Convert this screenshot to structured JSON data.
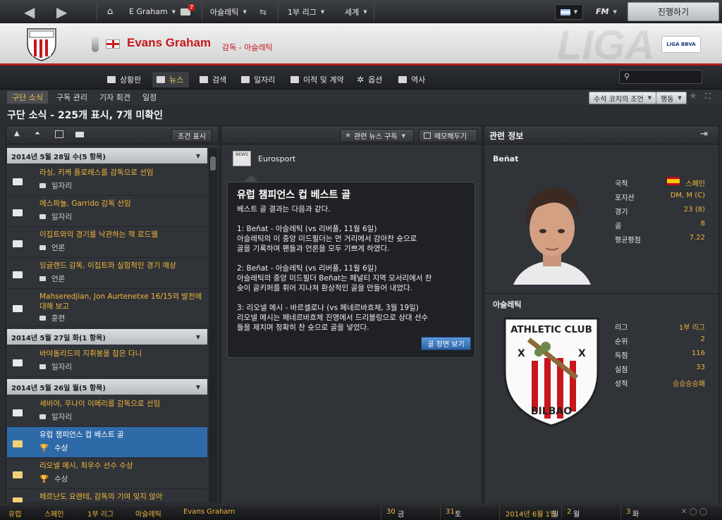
{
  "topbar": {
    "manager": "E Graham",
    "mail_badge": "7",
    "club": "아슬레틱",
    "league": "1부 리그",
    "world": "세계",
    "fm_label": "FM",
    "continue_label": "진행하기"
  },
  "header": {
    "manager_name": "Evans Graham",
    "role": "감독 - 아슬레틱",
    "league_logo": "LIGA BBVA"
  },
  "nav": {
    "tabs": [
      "상황판",
      "뉴스",
      "검색",
      "일자리",
      "이적 및 계약",
      "옵션",
      "역사"
    ],
    "active": "뉴스",
    "search_placeholder": ""
  },
  "subnav": {
    "tabs": [
      "구단 소식",
      "구독 관리",
      "기자 회견",
      "일정"
    ],
    "active": "구단 소식",
    "advice_button": "수석 코치의 조언",
    "action_button": "행동"
  },
  "page_heading": "구단 소식 - 225개 표시, 7개 미확인",
  "left_panel": {
    "filter_button": "조건 표시",
    "groups": [
      {
        "header": "2014년 5월 28일 수(5 항목)",
        "items": [
          {
            "title": "라싱, 키케 플로레스를 감독으로 선임",
            "category": "일자리",
            "read": false
          },
          {
            "title": "에스파뇰, Garrido 감독 선임",
            "category": "일자리",
            "read": false
          },
          {
            "title": "이집트와의 경기를 낙관하는 잭 로드웰",
            "category": "언론",
            "read": false
          },
          {
            "title": "잉글랜드 감독, 이집트와 실험적인 경기 예상",
            "category": "언론",
            "read": false
          },
          {
            "title": "Mahseredjian, Jon Aurtenetxe 16/15의 발전에 대해 보고",
            "category": "훈련",
            "read": false
          }
        ]
      },
      {
        "header": "2014년 5월 27일 화(1 항목)",
        "items": [
          {
            "title": "바야돌리드의 지휘봉을 잡은 다니",
            "category": "일자리",
            "read": false
          }
        ]
      },
      {
        "header": "2014년 5월 26일 월(5 항목)",
        "items": [
          {
            "title": "세비야, 우나이 이메리를 감독으로 선임",
            "category": "일자리",
            "read": false
          },
          {
            "title": "유럽 챔피언스 컵 베스트 골",
            "category": "수상",
            "read": true,
            "selected": true
          },
          {
            "title": "리오넬 메시, 최우수 선수 수상",
            "category": "수상",
            "read": true
          },
          {
            "title": "페르난도 요렌테, 감독의 기여 잊지 않아",
            "category": "",
            "read": true
          }
        ]
      }
    ]
  },
  "middle_panel": {
    "subscribe_button": "관련 뉴스 구독",
    "memo_button": "메모해두기",
    "source": "Eurosport",
    "source_icon": "NEWS",
    "article": {
      "title": "유럽 챔피언스 컵 베스트 골",
      "body": "베스트 골 결과는 다음과 같다.\n\n1: Beñat - 아슬레틱 (vs 리버풀, 11월 6일)\n아슬레틱의 이 중앙 미드필더는 먼 거리에서 감아찬 슛으로\n골을 기록하며 팬들과 언론을 모두 기쁘게 하였다.\n\n2: Beñat - 아슬레틱 (vs 리버풀, 11월 6일)\n아슬레틱의 중앙 미드필더 Beñat는 페널티 지역 모서리에서 찬\n슛이 골키퍼를 휘어 지나쳐 환상적인 골을 만들어 내었다.\n\n3: 리오넬 메시 - 바르셀로나 (vs 페네르바흐체, 3월 19일)\n리오넬 메시는 페네르바흐체 진영에서 드리블링으로 상대 선수\n들을 제치며 정확히 찬 슛으로 골을 넣었다.",
      "button": "골 장면 보기"
    }
  },
  "right_panel": {
    "title": "관련 정보",
    "player": {
      "name": "Beñat",
      "stats": [
        {
          "label": "국적",
          "value": "스페인"
        },
        {
          "label": "포지션",
          "value": "DM, M (C)"
        },
        {
          "label": "경기",
          "value": "23 (8)"
        },
        {
          "label": "골",
          "value": "8"
        },
        {
          "label": "평균평점",
          "value": "7.22"
        }
      ]
    },
    "club": {
      "name": "아슬레틱",
      "crest_top": "ATHLETIC CLUB",
      "crest_bottom": "BILBAO",
      "stats": [
        {
          "label": "리그",
          "value": "1부 리그"
        },
        {
          "label": "순위",
          "value": "2"
        },
        {
          "label": "득점",
          "value": "116"
        },
        {
          "label": "실점",
          "value": "33"
        },
        {
          "label": "성적",
          "value": "승승승승패"
        }
      ]
    }
  },
  "footer": {
    "breadcrumb": [
      "유럽",
      "스페인",
      "1부 리그",
      "아슬레틱",
      "Evans Graham"
    ],
    "days": [
      {
        "num": "30",
        "day": "금"
      },
      {
        "num": "31",
        "day": "토"
      }
    ],
    "date": "2014년 6월 1일",
    "date_day": "일",
    "days2": [
      {
        "num": "2",
        "day": "월"
      },
      {
        "num": "3",
        "day": "화"
      }
    ]
  },
  "colors": {
    "accent": "#f0b63c",
    "brand_red": "#c8161d",
    "selected": "#2f6aa8"
  }
}
